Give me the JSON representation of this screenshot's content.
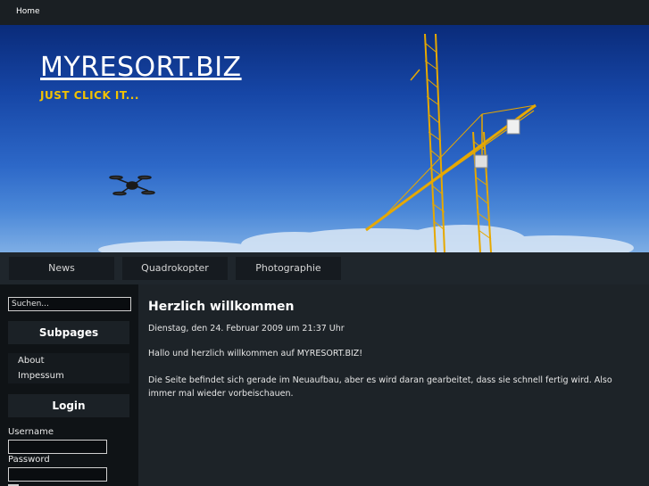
{
  "topbar": {
    "home_label": "Home"
  },
  "header": {
    "title": "MYRESORT.BIZ",
    "slogan": "JUST CLICK IT..."
  },
  "nav": {
    "items": [
      "News",
      "Quadrokopter",
      "Photographie"
    ]
  },
  "sidebar": {
    "search_placeholder": "Suchen...",
    "subpages_title": "Subpages",
    "subpages": [
      "About",
      "Impessum"
    ],
    "login_title": "Login",
    "username_label": "Username",
    "password_label": "Password"
  },
  "article": {
    "title": "Herzlich willkommen",
    "date": "Dienstag, den 24. Februar 2009 um 21:37 Uhr",
    "paragraphs": [
      "Hallo und herzlich willkommen auf MYRESORT.BIZ!",
      "Die Seite befindet sich gerade im Neuaufbau, aber es wird daran gearbeitet, dass sie schnell fertig wird. Also immer mal wieder vorbeischauen."
    ]
  },
  "colors": {
    "slogan": "#f2c200",
    "crane": "#f0b400",
    "sky_top": "#0a2b7a"
  },
  "icons": {
    "banner_drone": "quadcopter-drone",
    "banner_cranes": "construction-cranes"
  }
}
